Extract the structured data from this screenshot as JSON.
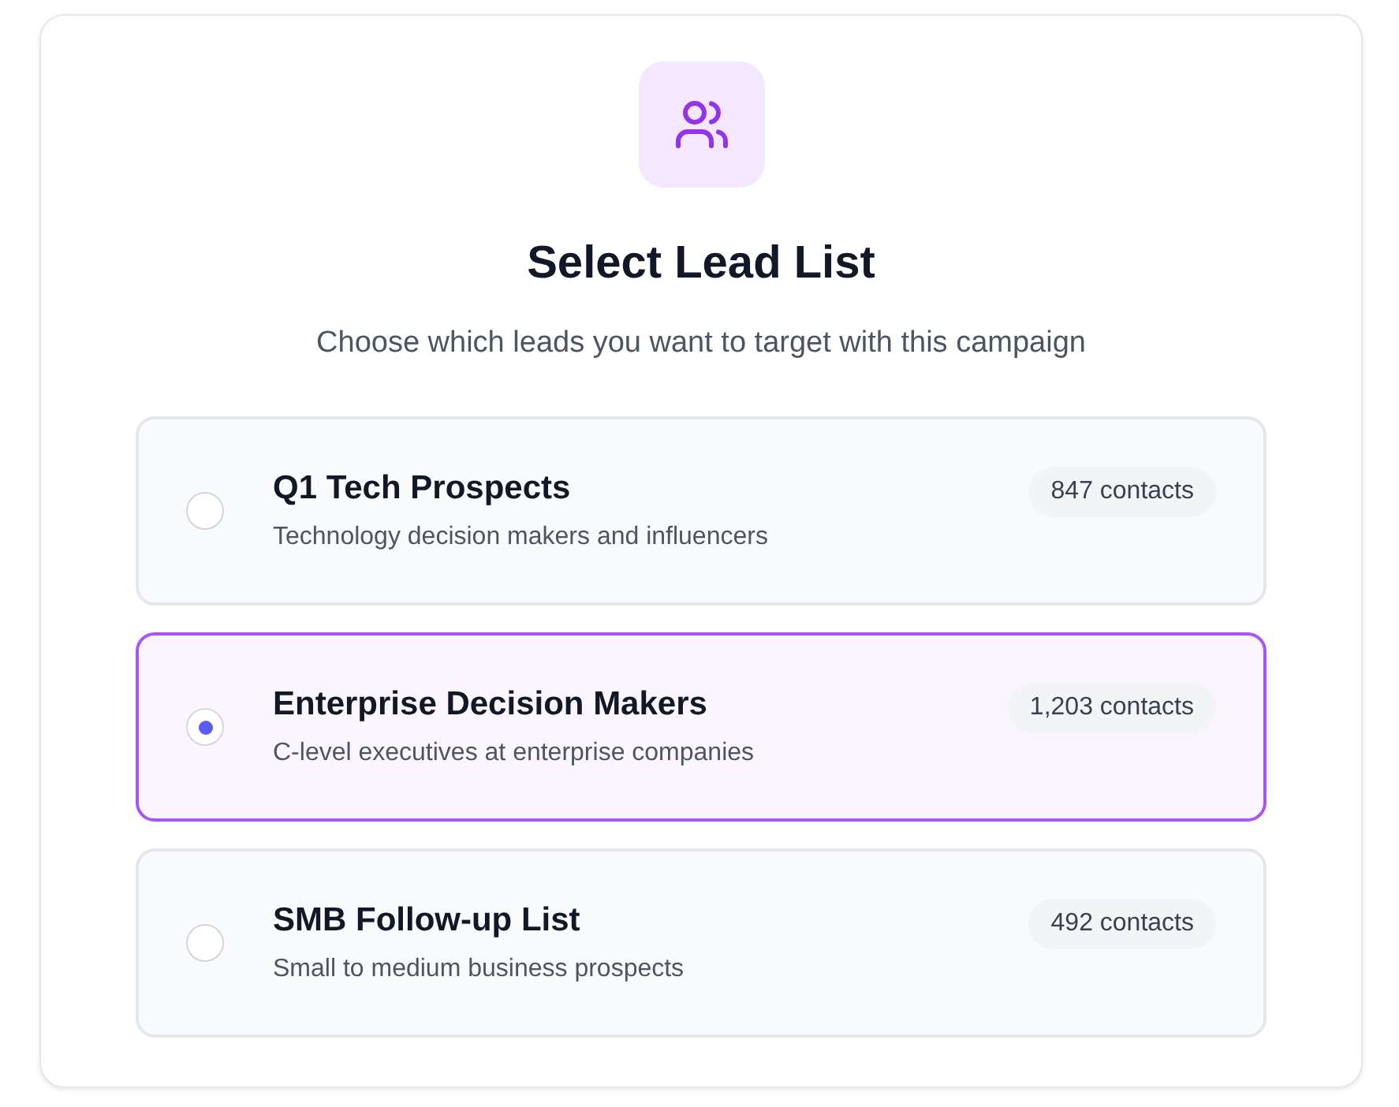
{
  "header": {
    "title": "Select Lead List",
    "subtitle": "Choose which leads you want to target with this campaign"
  },
  "lists": [
    {
      "name": "Q1 Tech Prospects",
      "description": "Technology decision makers and influencers",
      "count": "847 contacts",
      "selected": false
    },
    {
      "name": "Enterprise Decision Makers",
      "description": "C-level executives at enterprise companies",
      "count": "1,203 contacts",
      "selected": true
    },
    {
      "name": "SMB Follow-up List",
      "description": "Small to medium business prospects",
      "count": "492 contacts",
      "selected": false
    }
  ]
}
